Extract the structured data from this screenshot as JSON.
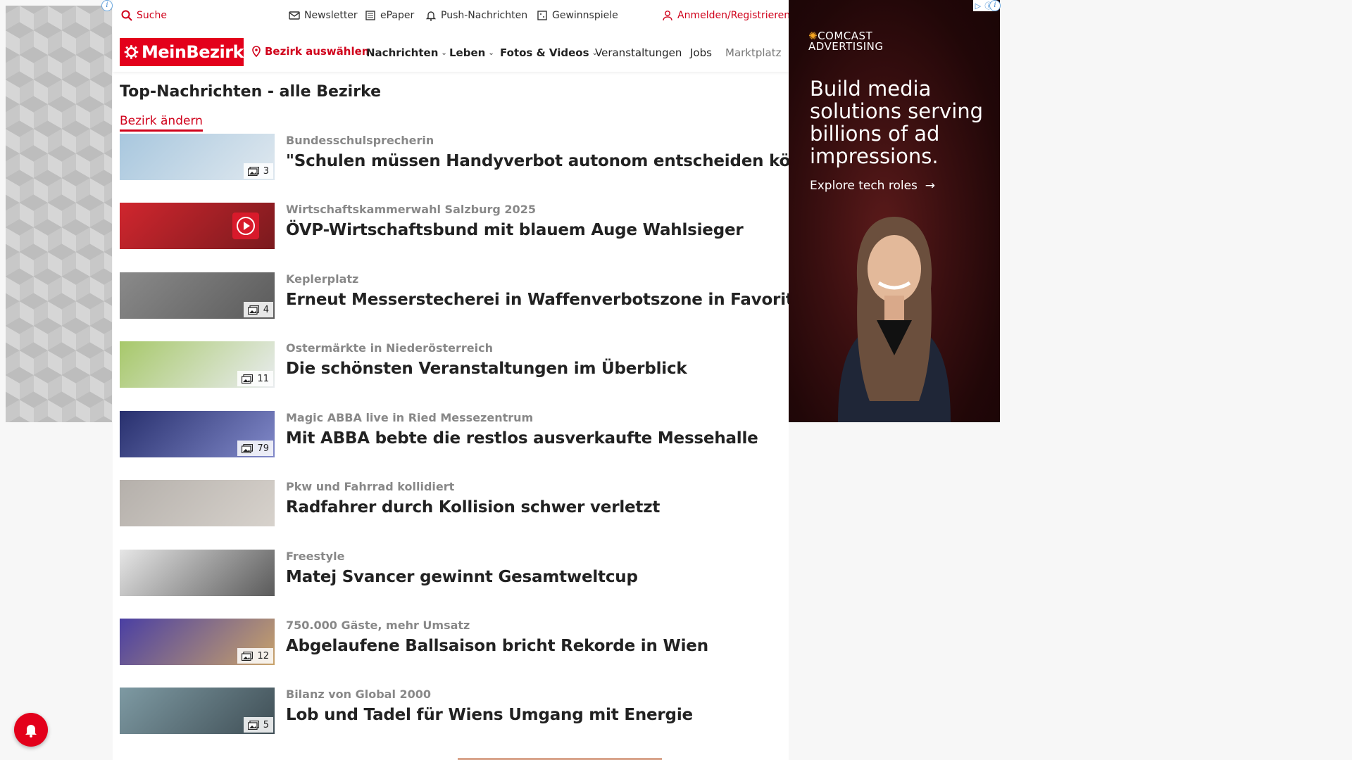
{
  "topbar": {
    "search": "Suche",
    "newsletter": "Newsletter",
    "epaper": "ePaper",
    "push": "Push-Nachrichten",
    "contests": "Gewinnspiele",
    "login": "Anmelden/Registrieren"
  },
  "nav": {
    "logo": "MeinBezirk",
    "district": "Bezirk auswählen",
    "items": [
      "Nachrichten",
      "Leben",
      "Fotos & Videos",
      "Veranstaltungen",
      "Jobs",
      "Marktplatz"
    ]
  },
  "section": {
    "title": "Top-Nachrichten - alle Bezirke",
    "change_link": "Bezirk ändern"
  },
  "articles": [
    {
      "kicker": "Bundesschulsprecherin",
      "headline": "\"Schulen müssen Handyverbot autonom entscheiden können\"",
      "count": "3",
      "thumb_colors": [
        "#a8c7de",
        "#dfe8ef"
      ]
    },
    {
      "kicker": "Wirtschaftskammerwahl Salzburg 2025",
      "headline": "ÖVP-Wirtschaftsbund mit blauem Auge Wahlsieger",
      "count": "",
      "thumb_colors": [
        "#d0262e",
        "#7a1a1e"
      ]
    },
    {
      "kicker": "Keplerplatz",
      "headline": "Erneut Messerstecherei in Waffenverbotszone in Favoriten",
      "count": "4",
      "thumb_colors": [
        "#8a8a8a",
        "#5b5b5b"
      ]
    },
    {
      "kicker": "Ostermärkte in Niederösterreich",
      "headline": "Die schönsten Veranstaltungen im Überblick",
      "count": "11",
      "thumb_colors": [
        "#a7c86a",
        "#e9ecef"
      ]
    },
    {
      "kicker": "Magic ABBA live in Ried Messezentrum",
      "headline": "Mit ABBA bebte die restlos ausverkaufte Messehalle",
      "count": "79",
      "thumb_colors": [
        "#28306e",
        "#8189c9"
      ]
    },
    {
      "kicker": "Pkw und Fahrrad kollidiert",
      "headline": "Radfahrer durch Kollision schwer verletzt",
      "count": "",
      "thumb_colors": [
        "#b5b0ab",
        "#d7d2cc"
      ]
    },
    {
      "kicker": "Freestyle",
      "headline": "Matej Svancer gewinnt Gesamtweltcup",
      "count": "",
      "thumb_colors": [
        "#e6e6e6",
        "#5a5a5a"
      ]
    },
    {
      "kicker": "750.000 Gäste, mehr Umsatz",
      "headline": "Abgelaufene Ballsaison bricht Rekorde in Wien",
      "count": "12",
      "thumb_colors": [
        "#4a3fa3",
        "#c9a36a"
      ]
    },
    {
      "kicker": "Bilanz von Global 2000",
      "headline": "Lob und Tadel für Wiens Umgang mit Energie",
      "count": "5",
      "thumb_colors": [
        "#7e9aa3",
        "#3f4e55"
      ]
    }
  ],
  "ad": {
    "brand_line1": "COMCAST",
    "brand_line2": "ADVERTISING",
    "headline": "Build media solutions serving billions of ad impressions.",
    "cta": "Explore tech roles"
  },
  "colors": {
    "brand_red": "#e3001b",
    "link_red": "#d0021b"
  }
}
